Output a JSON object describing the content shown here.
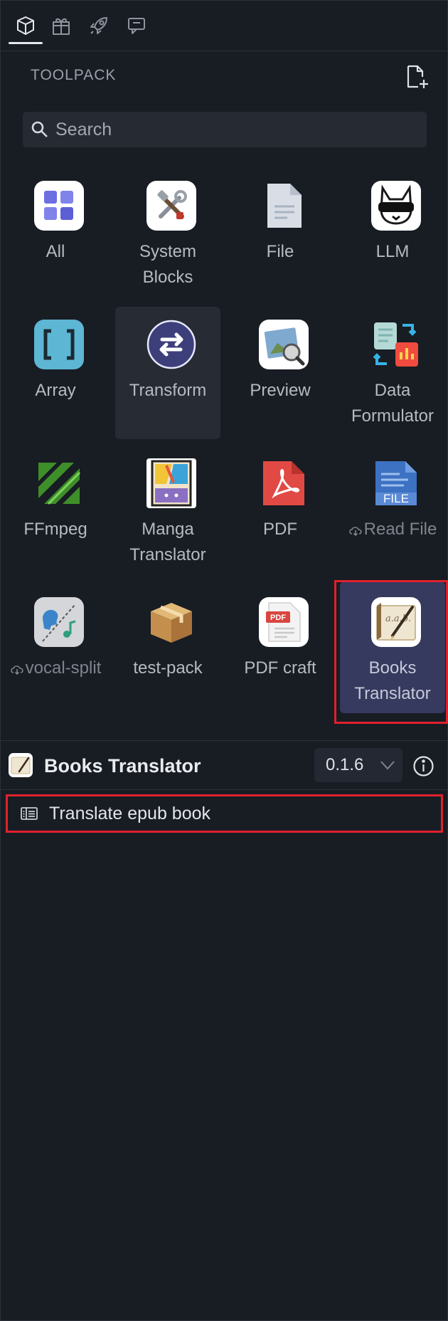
{
  "tabs": [
    {
      "name": "tab-packs",
      "icon": "cube-icon"
    },
    {
      "name": "tab-gifts",
      "icon": "gift-icon"
    },
    {
      "name": "tab-launch",
      "icon": "rocket-icon"
    },
    {
      "name": "tab-chat",
      "icon": "chat-icon"
    }
  ],
  "toolpack": {
    "label": "TOOLPACK",
    "new_pack_icon": "new-file-icon"
  },
  "search": {
    "placeholder": "Search",
    "value": ""
  },
  "packs": [
    {
      "label": "All",
      "icon": "grid-cubes-icon"
    },
    {
      "label": "System Blocks",
      "icon": "tools-icon"
    },
    {
      "label": "File",
      "icon": "file-icon"
    },
    {
      "label": "LLM",
      "icon": "llm-cat-icon"
    },
    {
      "label": "Array",
      "icon": "brackets-icon"
    },
    {
      "label": "Transform",
      "icon": "swap-arrows-icon"
    },
    {
      "label": "Preview",
      "icon": "preview-photo-icon"
    },
    {
      "label": "Data Formulator",
      "icon": "data-formulator-icon"
    },
    {
      "label": "FFmpeg",
      "icon": "ffmpeg-icon"
    },
    {
      "label": "Manga Translator",
      "icon": "manga-icon"
    },
    {
      "label": "PDF",
      "icon": "pdf-icon"
    },
    {
      "label": "Read File",
      "icon": "read-file-icon",
      "not_installed": true
    },
    {
      "label": "vocal-split",
      "icon": "vocal-split-icon",
      "not_installed": true
    },
    {
      "label": "test-pack",
      "icon": "package-box-icon"
    },
    {
      "label": "PDF craft",
      "icon": "pdf-craft-icon"
    },
    {
      "label": "Books Translator",
      "icon": "books-translator-icon",
      "selected": true
    }
  ],
  "selected_pack": {
    "title": "Books Translator",
    "version": "0.1.6",
    "info_icon": "info-icon"
  },
  "blocks": [
    {
      "label": "Translate epub book",
      "icon": "block-list-icon"
    }
  ],
  "colors": {
    "background": "#181c23",
    "selected": "#363a5e",
    "highlight": "#e0212c"
  }
}
